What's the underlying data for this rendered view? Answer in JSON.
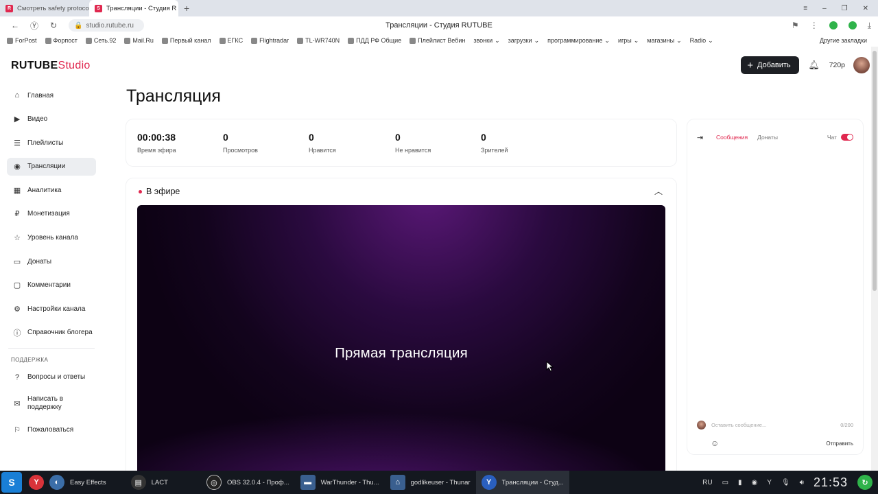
{
  "browser": {
    "tabs": [
      {
        "label": "Смотреть safety protocol",
        "active": false
      },
      {
        "label": "Трансляции - Студия R",
        "active": true
      }
    ],
    "url": "studio.rutube.ru",
    "page_title": "Трансляции - Студия RUTUBE",
    "bookmarks": [
      "ForPost",
      "Форпост",
      "Сеть.92",
      "Mail.Ru",
      "Первый канал",
      "ЕГКС",
      "Flightradar",
      "TL-WR740N",
      "ПДД РФ Общие",
      "Плейлист Вебин",
      "звонки",
      "загрузки",
      "программирование",
      "игры",
      "магазины",
      "Radio"
    ],
    "other_bookmarks": "Другие закладки"
  },
  "header": {
    "logo_main": "RUTUBE",
    "logo_suffix": "Studio",
    "add_button": "Добавить",
    "quality": "720p"
  },
  "sidebar": {
    "items": [
      {
        "label": "Главная",
        "icon": "home-icon"
      },
      {
        "label": "Видео",
        "icon": "video-icon"
      },
      {
        "label": "Плейлисты",
        "icon": "playlist-icon"
      },
      {
        "label": "Трансляции",
        "icon": "broadcast-icon"
      },
      {
        "label": "Аналитика",
        "icon": "analytics-icon"
      },
      {
        "label": "Монетизация",
        "icon": "monetization-icon"
      },
      {
        "label": "Уровень канала",
        "icon": "star-icon"
      },
      {
        "label": "Донаты",
        "icon": "donate-icon"
      },
      {
        "label": "Комментарии",
        "icon": "comments-icon"
      },
      {
        "label": "Настройки канала",
        "icon": "gear-icon"
      },
      {
        "label": "Справочник блогера",
        "icon": "help-icon"
      }
    ],
    "support_section": "ПОДДЕРЖКА",
    "support_items": [
      {
        "label": "Вопросы и ответы"
      },
      {
        "label": "Написать в поддержку"
      },
      {
        "label": "Пожаловаться"
      }
    ]
  },
  "main": {
    "title": "Трансляция",
    "stats": [
      {
        "value": "00:00:38",
        "label": "Время эфира"
      },
      {
        "value": "0",
        "label": "Просмотров"
      },
      {
        "value": "0",
        "label": "Нравится"
      },
      {
        "value": "0",
        "label": "Не нравится"
      },
      {
        "value": "0",
        "label": "Зрителей"
      }
    ],
    "live_label": "В эфире",
    "player_text": "Прямая трансляция"
  },
  "chat": {
    "tab_messages": "Сообщения",
    "tab_donates": "Донаты",
    "toggle_label": "Чат",
    "chat_enabled": true,
    "placeholder": "Оставить сообщение...",
    "counter": "0/200",
    "send": "Отправить"
  },
  "taskbar": {
    "items": [
      {
        "label": "Easy Effects"
      },
      {
        "label": "LACT"
      },
      {
        "label": "OBS 32.0.4 - Проф..."
      },
      {
        "label": "WarThunder - Thu..."
      },
      {
        "label": "godlikeuser - Thunar"
      },
      {
        "label": "Трансляции - Студ..."
      }
    ],
    "lang": "RU",
    "clock": "21:53"
  },
  "colors": {
    "accent": "#e0284f",
    "dark_button": "#1d1f24"
  }
}
